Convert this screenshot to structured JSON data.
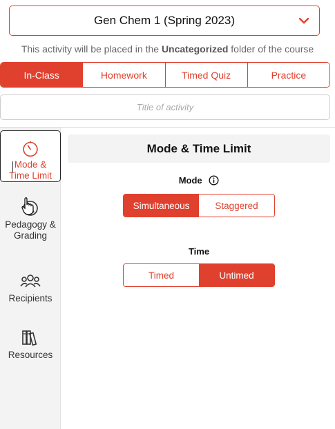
{
  "course": {
    "selected": "Gen Chem 1 (Spring 2023)",
    "icon": "chevron-down-icon"
  },
  "placement": {
    "prefix": "This activity will be placed in the ",
    "folder": "Uncategorized",
    "suffix": " folder of the course"
  },
  "activity_types": [
    {
      "label": "In-Class",
      "active": true
    },
    {
      "label": "Homework",
      "active": false
    },
    {
      "label": "Timed Quiz",
      "active": false
    },
    {
      "label": "Practice",
      "active": false
    }
  ],
  "title_field": {
    "value": "",
    "placeholder": "Title of activity"
  },
  "sidebar": {
    "items": [
      {
        "label_line1": "Mode &",
        "label_line2": "Time Limit",
        "icon": "timer-icon",
        "active": true
      },
      {
        "label_line1": "Pedagogy &",
        "label_line2": "Grading",
        "icon": "pedagogy-icon",
        "active": false
      },
      {
        "label_line1": "Recipients",
        "label_line2": "",
        "icon": "users-icon",
        "active": false
      },
      {
        "label_line1": "Resources",
        "label_line2": "",
        "icon": "books-icon",
        "active": false
      }
    ]
  },
  "panel": {
    "title": "Mode & Time Limit",
    "mode": {
      "label": "Mode",
      "options": [
        "Simultaneous",
        "Staggered"
      ],
      "selected": "Simultaneous"
    },
    "time": {
      "label": "Time",
      "options": [
        "Timed",
        "Untimed"
      ],
      "selected": "Untimed"
    }
  },
  "colors": {
    "accent": "#e0402e",
    "sidebar_bg": "#f4f3f3"
  }
}
